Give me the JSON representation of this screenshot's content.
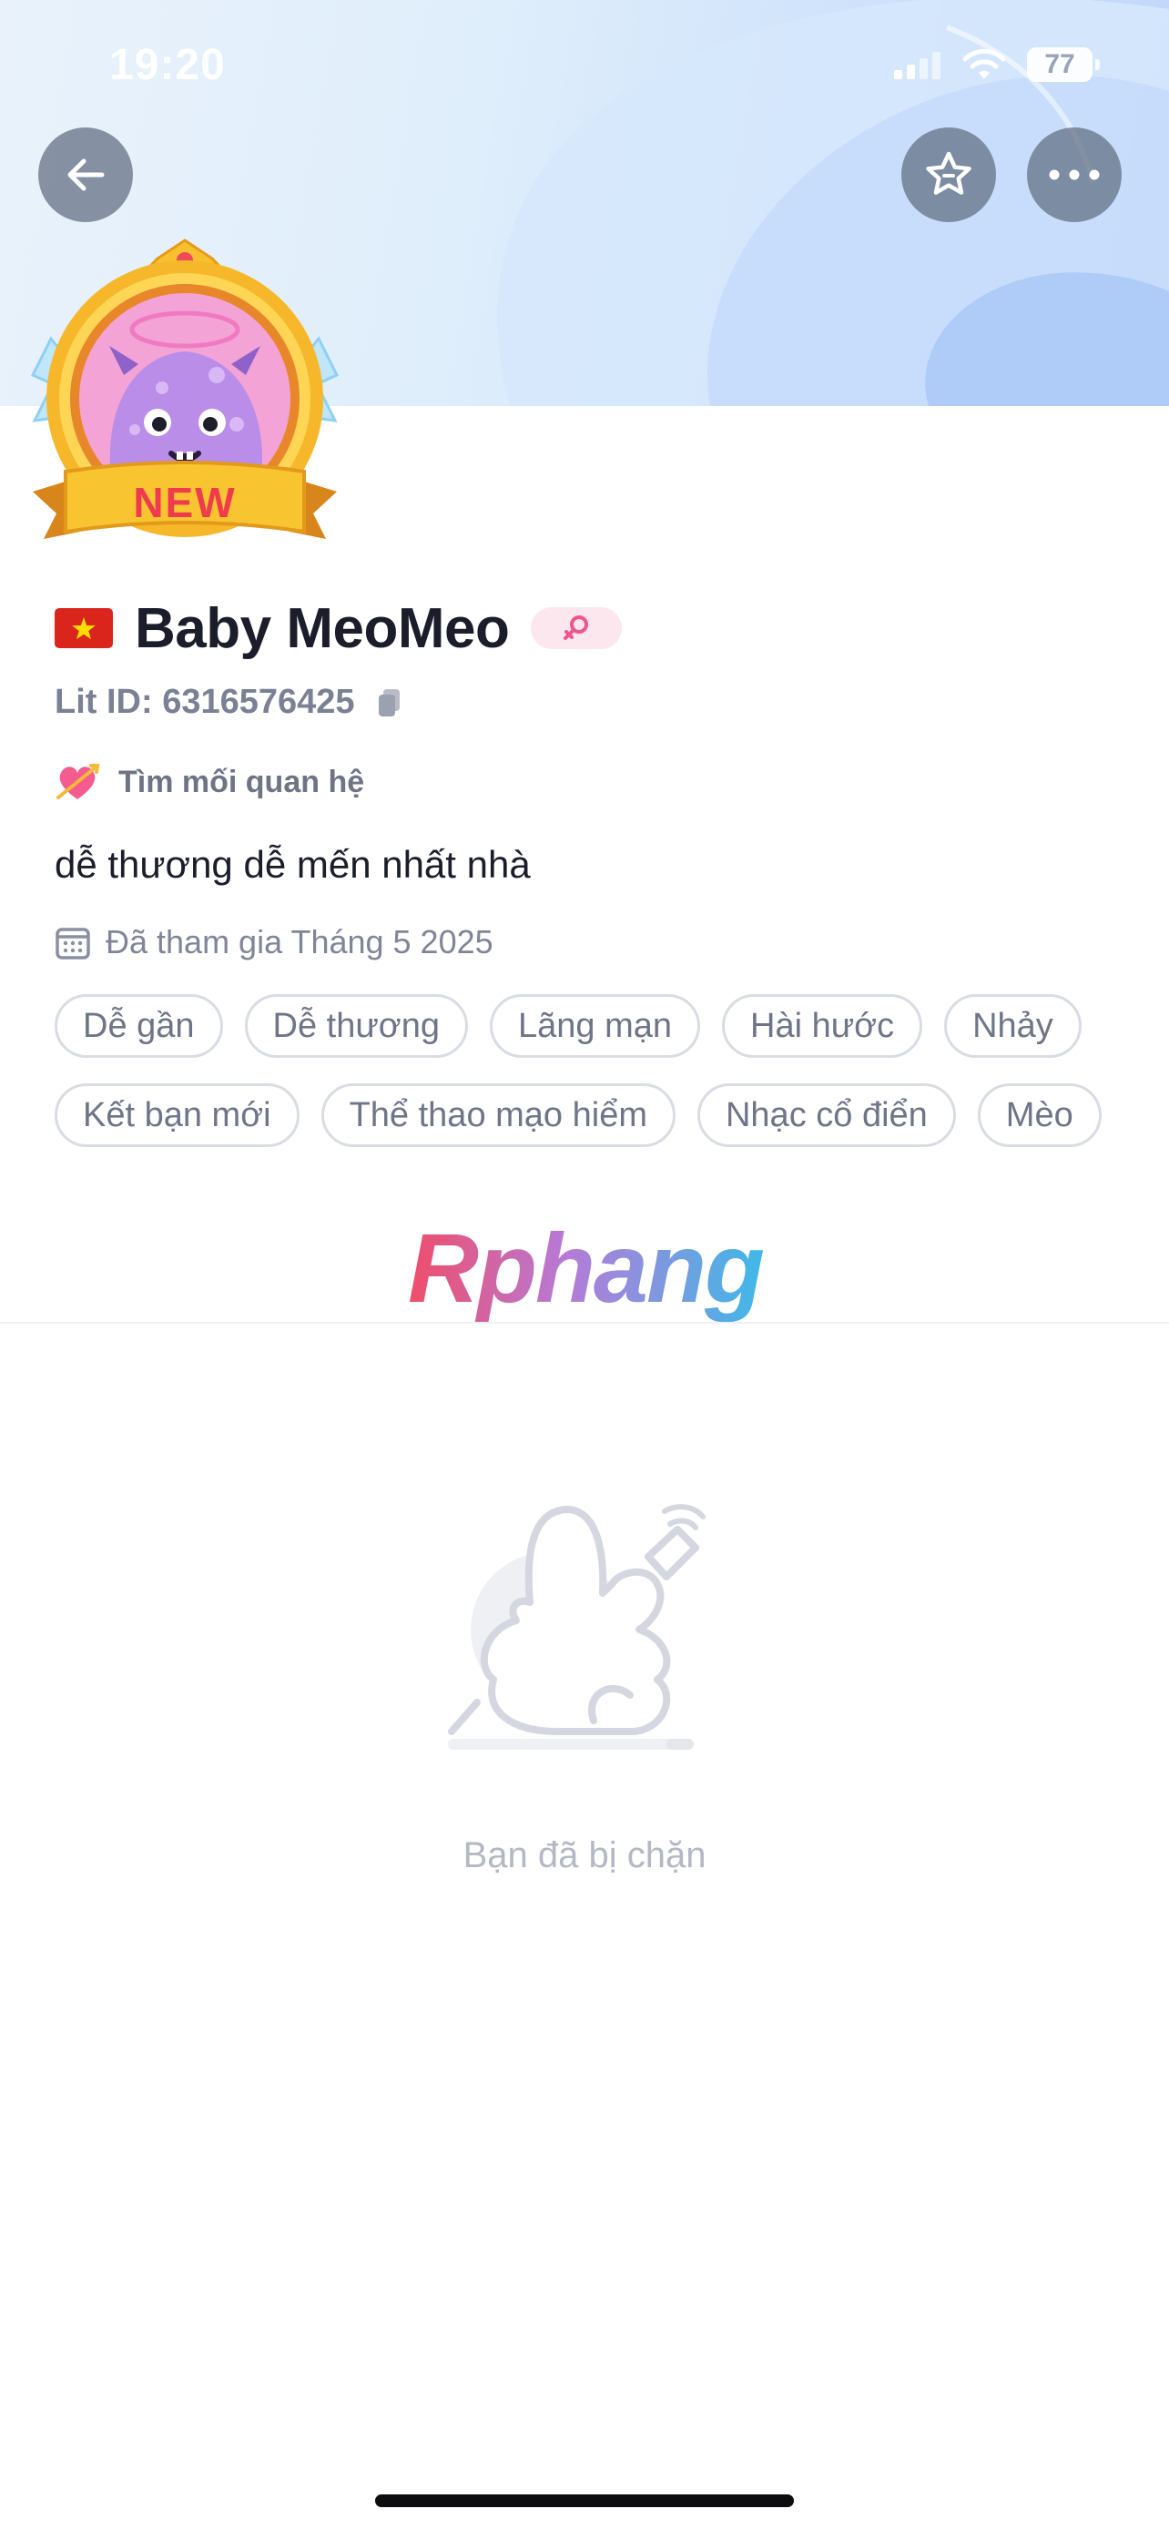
{
  "status_bar": {
    "time": "19:20",
    "battery": "77",
    "icons": [
      "signal-icon",
      "wifi-icon",
      "battery-icon"
    ]
  },
  "header": {
    "back_icon": "arrow-left-icon",
    "favorite_icon": "star-icon",
    "more_icon": "more-horizontal-icon"
  },
  "profile": {
    "badge_text": "NEW",
    "flag": "vietnam-flag",
    "name": "Baby MeoMeo",
    "gender_icon": "female-icon",
    "lit_id": "Lit ID: 6316576425",
    "relationship": "Tìm mối quan hệ",
    "bio": "dễ thương dễ mến nhất nhà",
    "joined": "Đã tham gia Tháng 5 2025",
    "tags": [
      "Dễ gần",
      "Dễ thương",
      "Lãng mạn",
      "Hài hước",
      "Nhảy",
      "Kết bạn mới",
      "Thể thao mạo hiểm",
      "Nhạc cổ điển",
      "Mèo"
    ]
  },
  "watermark": "Rphang",
  "empty_state": {
    "icon": "blocked-hand-illustration",
    "message": "Bạn đã bị chặn"
  },
  "colors": {
    "header_gradient_start": "#e9f2fb",
    "header_gradient_end": "#bfd6fa",
    "tag_border": "#d9dce3",
    "gender_pill_bg": "#fde7ef",
    "gender_icon": "#f2558d",
    "muted_text": "#7b8194"
  }
}
